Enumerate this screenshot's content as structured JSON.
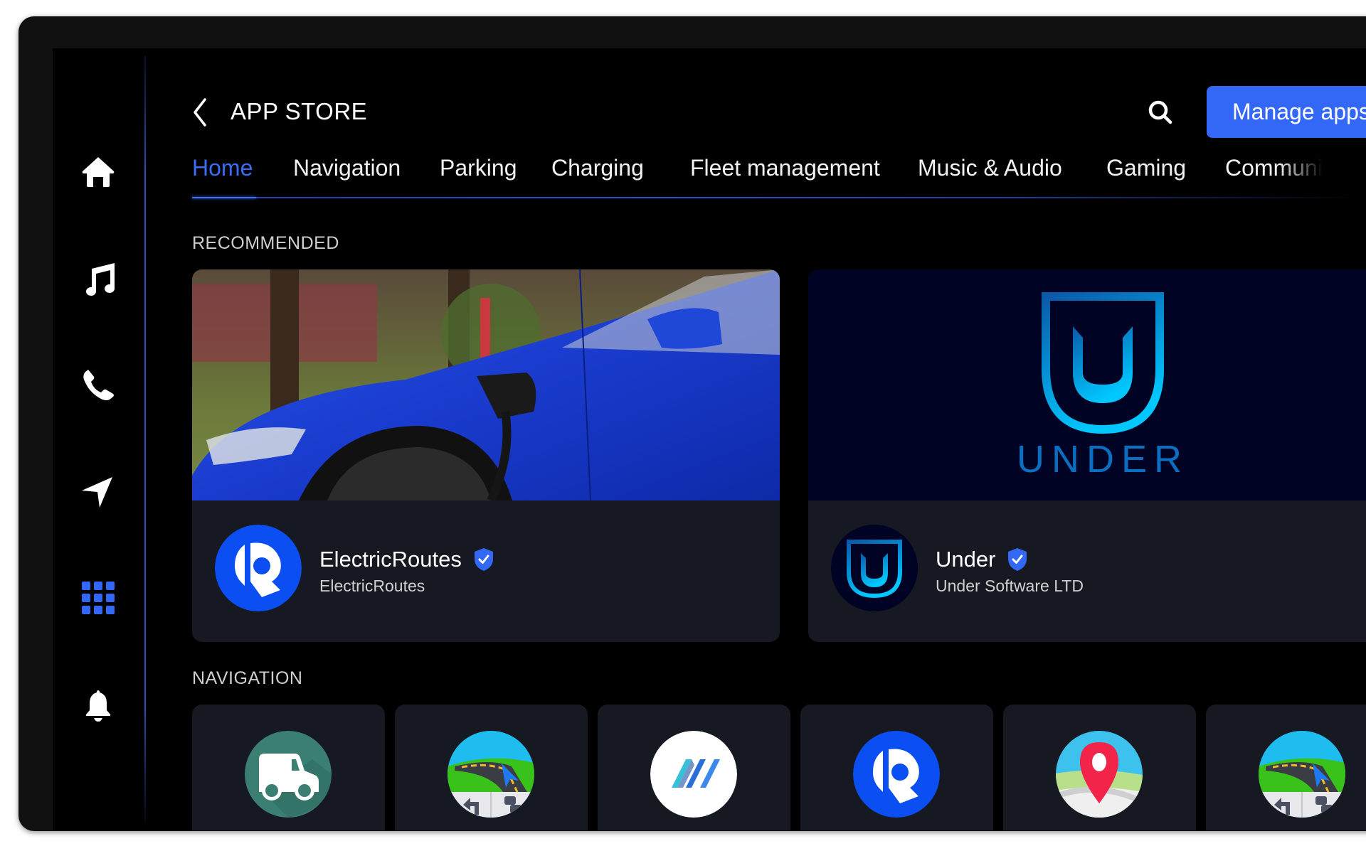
{
  "sidebar": {
    "items": [
      {
        "name": "home",
        "icon": "home-icon",
        "active": false
      },
      {
        "name": "music",
        "icon": "music-note-icon",
        "active": false
      },
      {
        "name": "phone",
        "icon": "phone-icon",
        "active": false
      },
      {
        "name": "navigation",
        "icon": "navigation-arrow-icon",
        "active": false
      },
      {
        "name": "apps",
        "icon": "app-grid-icon",
        "active": true
      },
      {
        "name": "notifications",
        "icon": "bell-icon",
        "active": false
      }
    ]
  },
  "header": {
    "back_icon": "chevron-left-icon",
    "title": "APP STORE",
    "search_icon": "search-icon",
    "manage_button": "Manage apps"
  },
  "tabs": [
    {
      "label": "Home",
      "active": true
    },
    {
      "label": "Navigation",
      "active": false
    },
    {
      "label": "Parking",
      "active": false
    },
    {
      "label": "Charging",
      "active": false
    },
    {
      "label": "Fleet management",
      "active": false
    },
    {
      "label": "Music & Audio",
      "active": false
    },
    {
      "label": "Gaming",
      "active": false
    },
    {
      "label": "Communi",
      "active": false
    }
  ],
  "sections": {
    "recommended": {
      "label": "RECOMMENDED",
      "cards": [
        {
          "name": "ElectricRoutes",
          "developer": "ElectricRoutes",
          "verified": true,
          "banner": "blue electric car charging photo"
        },
        {
          "name": "Under",
          "developer": "Under Software LTD",
          "verified": true,
          "banner_text": "UNDER"
        }
      ]
    },
    "navigation": {
      "label": "NAVIGATION",
      "apps": [
        {
          "icon": "delivery-van-icon"
        },
        {
          "icon": "road-navigation-icon"
        },
        {
          "icon": "w-logo-icon"
        },
        {
          "icon": "electricroutes-logo-icon"
        },
        {
          "icon": "map-pin-icon"
        },
        {
          "icon": "road-navigation-icon"
        }
      ]
    }
  },
  "colors": {
    "accent": "#3367f5",
    "active_tab": "#3b6cf5",
    "card_bg": "#161922",
    "under_banner_bg": "#000324",
    "screen_bg": "#000000"
  }
}
